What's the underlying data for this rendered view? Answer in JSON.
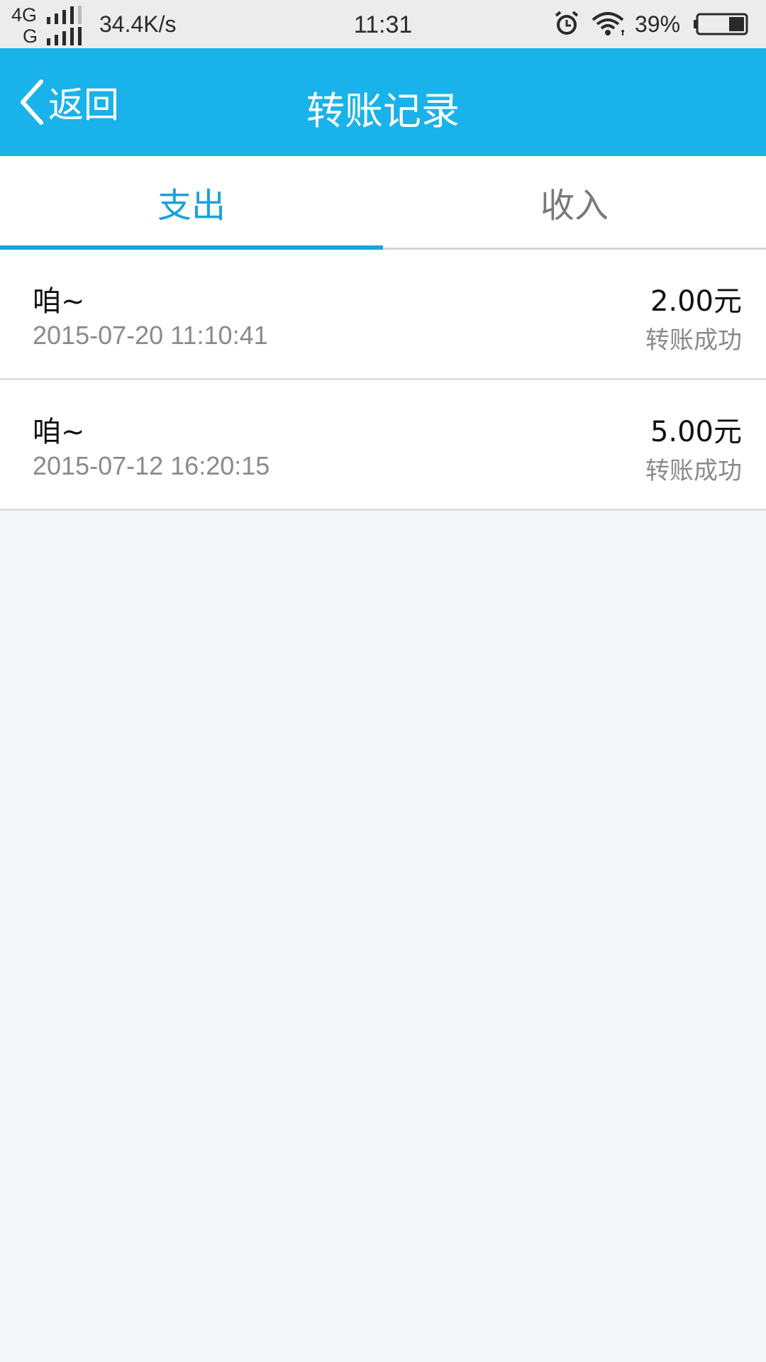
{
  "status_bar": {
    "network_top": "4G",
    "network_bottom": "G",
    "speed": "34.4K/s",
    "time": "11:31",
    "battery_percent": "39%",
    "icons": [
      "signal-icon",
      "alarm-icon",
      "wifi-icon",
      "battery-icon"
    ]
  },
  "nav": {
    "back_label": "返回",
    "title": "转账记录",
    "background_color": "#19b2ea"
  },
  "tabs": [
    {
      "label": "支出",
      "active": true
    },
    {
      "label": "收入",
      "active": false
    }
  ],
  "transactions": [
    {
      "name": "咱~",
      "time": "2015-07-20 11:10:41",
      "amount": "2.00元",
      "status": "转账成功"
    },
    {
      "name": "咱~",
      "time": "2015-07-12 16:20:15",
      "amount": "5.00元",
      "status": "转账成功"
    }
  ],
  "colors": {
    "accent": "#1aa3da",
    "background": "#f6f7f9"
  }
}
